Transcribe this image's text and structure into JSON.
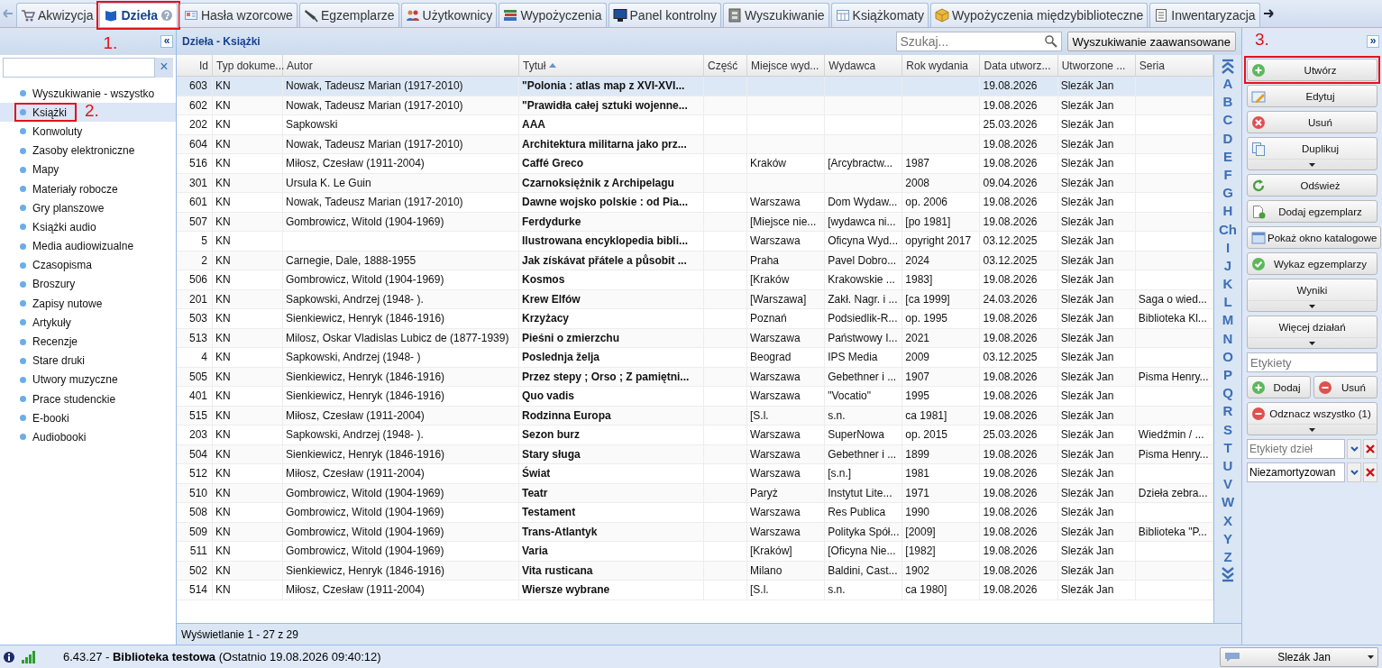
{
  "tabs": [
    {
      "label": "Akwizycja",
      "selected": false
    },
    {
      "label": "Dzieła",
      "selected": true,
      "annotation": "1."
    },
    {
      "label": "Hasła wzorcowe",
      "selected": false
    },
    {
      "label": "Egzemplarze",
      "selected": false
    },
    {
      "label": "Użytkownicy",
      "selected": false
    },
    {
      "label": "Wypożyczenia",
      "selected": false
    },
    {
      "label": "Panel kontrolny",
      "selected": false
    },
    {
      "label": "Wyszukiwanie",
      "selected": false
    },
    {
      "label": "Książkomaty",
      "selected": false
    },
    {
      "label": "Wypożyczenia międzybiblioteczne",
      "selected": false
    },
    {
      "label": "Inwentaryzacja",
      "selected": false
    }
  ],
  "sidebar": {
    "collapse": "«",
    "clear": "×",
    "items": [
      {
        "label": "Wyszukiwanie - wszystko",
        "selected": false
      },
      {
        "label": "Książki",
        "selected": true,
        "annotation": "2."
      },
      {
        "label": "Konwoluty",
        "selected": false
      },
      {
        "label": "Zasoby elektroniczne",
        "selected": false
      },
      {
        "label": "Mapy",
        "selected": false
      },
      {
        "label": "Materiały robocze",
        "selected": false
      },
      {
        "label": "Gry planszowe",
        "selected": false
      },
      {
        "label": "Książki audio",
        "selected": false
      },
      {
        "label": "Media audiowizualne",
        "selected": false
      },
      {
        "label": "Czasopisma",
        "selected": false
      },
      {
        "label": "Broszury",
        "selected": false
      },
      {
        "label": "Zapisy nutowe",
        "selected": false
      },
      {
        "label": "Artykuły",
        "selected": false
      },
      {
        "label": "Recenzje",
        "selected": false
      },
      {
        "label": "Stare druki",
        "selected": false
      },
      {
        "label": "Utwory muzyczne",
        "selected": false
      },
      {
        "label": "Prace studenckie",
        "selected": false
      },
      {
        "label": "E-booki",
        "selected": false
      },
      {
        "label": "Audiobooki",
        "selected": false
      }
    ]
  },
  "panel": {
    "title": "Dzieła - Książki",
    "search": {
      "placeholder": "Szukaj..."
    },
    "advanced_search": "Wyszukiwanie zaawansowane",
    "expand": "»",
    "annotation": "3."
  },
  "table": {
    "columns": [
      {
        "label": "Id",
        "sorted": false
      },
      {
        "label": "Typ dokume...",
        "sorted": false
      },
      {
        "label": "Autor",
        "sorted": false
      },
      {
        "label": "Tytuł",
        "sorted": true
      },
      {
        "label": "Część",
        "sorted": false
      },
      {
        "label": "Miejsce wyd...",
        "sorted": false
      },
      {
        "label": "Wydawca",
        "sorted": false
      },
      {
        "label": "Rok wydania",
        "sorted": false
      },
      {
        "label": "Data utworz...",
        "sorted": false
      },
      {
        "label": "Utworzone ...",
        "sorted": false
      },
      {
        "label": "Seria",
        "sorted": false
      }
    ],
    "rows": [
      {
        "selected": true,
        "id": "603",
        "type": "KN",
        "author": "Nowak, Tadeusz Marian (1917-2010)",
        "title": "\"Polonia : atlas map z XVI-XVI...",
        "created": "19.08.2026",
        "created_by": "Slezák Jan"
      },
      {
        "selected": false,
        "id": "602",
        "type": "KN",
        "author": "Nowak, Tadeusz Marian (1917-2010)",
        "title": "\"Prawidła całej sztuki wojenne...",
        "created": "19.08.2026",
        "created_by": "Slezák Jan"
      },
      {
        "selected": false,
        "id": "202",
        "type": "KN",
        "author": "Sapkowski",
        "title": "AAA",
        "created": "25.03.2026",
        "created_by": "Slezák Jan"
      },
      {
        "selected": false,
        "id": "604",
        "type": "KN",
        "author": "Nowak, Tadeusz Marian (1917-2010)",
        "title": "Architektura militarna jako prz...",
        "created": "19.08.2026",
        "created_by": "Slezák Jan"
      },
      {
        "selected": false,
        "id": "516",
        "type": "KN",
        "author": "Miłosz, Czesław (1911-2004)",
        "title": "Caffé Greco",
        "place": "Kraków",
        "publisher": "[Arcybractw...",
        "year": "1987",
        "created": "19.08.2026",
        "created_by": "Slezák Jan"
      },
      {
        "selected": false,
        "id": "301",
        "type": "KN",
        "author": "Ursula K. Le Guin",
        "title": "Czarnoksiężnik z Archipelagu",
        "year": "2008",
        "created": "09.04.2026",
        "created_by": "Slezák Jan"
      },
      {
        "selected": false,
        "id": "601",
        "type": "KN",
        "author": "Nowak, Tadeusz Marian (1917-2010)",
        "title": "Dawne wojsko polskie : od Pia...",
        "place": "Warszawa",
        "publisher": "Dom Wydaw...",
        "year": "op. 2006",
        "created": "19.08.2026",
        "created_by": "Slezák Jan"
      },
      {
        "selected": false,
        "id": "507",
        "type": "KN",
        "author": "Gombrowicz, Witold (1904-1969)",
        "title": "Ferdydurke",
        "place": "[Miejsce nie...",
        "publisher": "[wydawca ni...",
        "year": "[po 1981]",
        "created": "19.08.2026",
        "created_by": "Slezák Jan"
      },
      {
        "selected": false,
        "id": "5",
        "type": "KN",
        "title": "Ilustrowana encyklopedia bibli...",
        "place": "Warszawa",
        "publisher": "Oficyna Wyd...",
        "year": "opyright 2017",
        "created": "03.12.2025",
        "created_by": "Slezák Jan"
      },
      {
        "selected": false,
        "id": "2",
        "type": "KN",
        "author": "Carnegie, Dale, 1888-1955",
        "title": "Jak získávat přátele a působit ...",
        "place": "Praha",
        "publisher": "Pavel Dobro...",
        "year": "2024",
        "created": "03.12.2025",
        "created_by": "Slezák Jan"
      },
      {
        "selected": false,
        "id": "506",
        "type": "KN",
        "author": "Gombrowicz, Witold (1904-1969)",
        "title": "Kosmos",
        "place": "[Kraków",
        "publisher": "Krakowskie ...",
        "year": "1983]",
        "created": "19.08.2026",
        "created_by": "Slezák Jan"
      },
      {
        "selected": false,
        "id": "201",
        "type": "KN",
        "author": "Sapkowski, Andrzej (1948- ).",
        "title": "Krew Elfów",
        "place": "[Warszawa]",
        "publisher": "Zakł. Nagr. i ...",
        "year": "[ca 1999]",
        "created": "24.03.2026",
        "created_by": "Slezák Jan",
        "series": "Saga o wied..."
      },
      {
        "selected": false,
        "id": "503",
        "type": "KN",
        "author": "Sienkiewicz, Henryk (1846-1916)",
        "title": "Krzyżacy",
        "place": "Poznań",
        "publisher": "Podsiedlik-R...",
        "year": "op. 1995",
        "created": "19.08.2026",
        "created_by": "Slezák Jan",
        "series": "Biblioteka Kl..."
      },
      {
        "selected": false,
        "id": "513",
        "type": "KN",
        "author": "Milosz, Oskar Vladislas Lubicz de (1877-1939)",
        "title": "Pieśni o zmierzchu",
        "place": "Warszawa",
        "publisher": "Państwowy I...",
        "year": "2021",
        "created": "19.08.2026",
        "created_by": "Slezák Jan"
      },
      {
        "selected": false,
        "id": "4",
        "type": "KN",
        "author": "Sapkowski, Andrzej (1948- )",
        "title": "Poslednja želja",
        "place": "Beograd",
        "publisher": "IPS Media",
        "year": "2009",
        "created": "03.12.2025",
        "created_by": "Slezák Jan"
      },
      {
        "selected": false,
        "id": "505",
        "type": "KN",
        "author": "Sienkiewicz, Henryk (1846-1916)",
        "title": "Przez stepy ; Orso ; Z pamiętni...",
        "place": "Warszawa",
        "publisher": "Gebethner i ...",
        "year": "1907",
        "created": "19.08.2026",
        "created_by": "Slezák Jan",
        "series": "Pisma Henry..."
      },
      {
        "selected": false,
        "id": "401",
        "type": "KN",
        "author": "Sienkiewicz, Henryk (1846-1916)",
        "title": "Quo vadis",
        "place": "Warszawa",
        "publisher": "\"Vocatio\"",
        "year": "1995",
        "created": "19.08.2026",
        "created_by": "Slezák Jan"
      },
      {
        "selected": false,
        "id": "515",
        "type": "KN",
        "author": "Miłosz, Czesław (1911-2004)",
        "title": "Rodzinna Europa",
        "place": "[S.l.",
        "publisher": "s.n.",
        "year": "ca 1981]",
        "created": "19.08.2026",
        "created_by": "Slezák Jan"
      },
      {
        "selected": false,
        "id": "203",
        "type": "KN",
        "author": "Sapkowski, Andrzej (1948- ).",
        "title": "Sezon burz",
        "place": "Warszawa",
        "publisher": "SuperNowa",
        "year": "op. 2015",
        "created": "25.03.2026",
        "created_by": "Slezák Jan",
        "series": "Wiedźmin / ..."
      },
      {
        "selected": false,
        "id": "504",
        "type": "KN",
        "author": "Sienkiewicz, Henryk (1846-1916)",
        "title": "Stary sługa",
        "place": "Warszawa",
        "publisher": "Gebethner i ...",
        "year": "1899",
        "created": "19.08.2026",
        "created_by": "Slezák Jan",
        "series": "Pisma Henry..."
      },
      {
        "selected": false,
        "id": "512",
        "type": "KN",
        "author": "Miłosz, Czesław (1911-2004)",
        "title": "Świat",
        "place": "Warszawa",
        "publisher": "[s.n.]",
        "year": "1981",
        "created": "19.08.2026",
        "created_by": "Slezák Jan"
      },
      {
        "selected": false,
        "id": "510",
        "type": "KN",
        "author": "Gombrowicz, Witold (1904-1969)",
        "title": "Teatr",
        "place": "Paryż",
        "publisher": "Instytut Lite...",
        "year": "1971",
        "created": "19.08.2026",
        "created_by": "Slezák Jan",
        "series": "Dzieła zebra..."
      },
      {
        "selected": false,
        "id": "508",
        "type": "KN",
        "author": "Gombrowicz, Witold (1904-1969)",
        "title": "Testament",
        "place": "Warszawa",
        "publisher": "Res Publica",
        "year": "1990",
        "created": "19.08.2026",
        "created_by": "Slezák Jan"
      },
      {
        "selected": false,
        "id": "509",
        "type": "KN",
        "author": "Gombrowicz, Witold (1904-1969)",
        "title": "Trans-Atlantyk",
        "place": "Warszawa",
        "publisher": "Polityka Spół...",
        "year": "[2009]",
        "created": "19.08.2026",
        "created_by": "Slezák Jan",
        "series": "Biblioteka \"P..."
      },
      {
        "selected": false,
        "id": "511",
        "type": "KN",
        "author": "Gombrowicz, Witold (1904-1969)",
        "title": "Varia",
        "place": "[Kraków]",
        "publisher": "[Oficyna Nie...",
        "year": "[1982]",
        "created": "19.08.2026",
        "created_by": "Slezák Jan"
      },
      {
        "selected": false,
        "id": "502",
        "type": "KN",
        "author": "Sienkiewicz, Henryk (1846-1916)",
        "title": "Vita rusticana",
        "place": "Milano",
        "publisher": "Baldini, Cast...",
        "year": "1902",
        "created": "19.08.2026",
        "created_by": "Slezák Jan"
      },
      {
        "selected": false,
        "id": "514",
        "type": "KN",
        "author": "Miłosz, Czesław (1911-2004)",
        "title": "Wiersze wybrane",
        "place": "[S.l.",
        "publisher": "s.n.",
        "year": "ca 1980]",
        "created": "19.08.2026",
        "created_by": "Slezák Jan"
      }
    ],
    "footer": "Wyświetlanie 1 - 27 z 29"
  },
  "alphabet": [
    "A",
    "B",
    "C",
    "D",
    "E",
    "F",
    "G",
    "H",
    "Ch",
    "I",
    "J",
    "K",
    "L",
    "M",
    "N",
    "O",
    "P",
    "Q",
    "R",
    "S",
    "T",
    "U",
    "V",
    "W",
    "X",
    "Y",
    "Z"
  ],
  "actions": {
    "buttons": [
      {
        "label": "Utwórz",
        "kind": "button",
        "annotated": true
      },
      {
        "label": "Edytuj",
        "kind": "button",
        "annotated": false
      },
      {
        "label": "Usuń",
        "kind": "button",
        "annotated": false
      },
      {
        "label": "Duplikuj",
        "kind": "menu",
        "annotated": false
      },
      {
        "label": "Odśwież",
        "kind": "button",
        "annotated": false
      },
      {
        "label": "Dodaj egzemplarz",
        "kind": "button",
        "annotated": false
      },
      {
        "label": "Pokaż okno katalogowe",
        "kind": "button",
        "annotated": false
      },
      {
        "label": "Wykaz egzemplarzy",
        "kind": "button",
        "annotated": false
      },
      {
        "label": "Wyniki",
        "kind": "menu",
        "annotated": false
      },
      {
        "label": "Więcej działań",
        "kind": "menu",
        "annotated": false
      }
    ],
    "labels_field": {
      "placeholder": "Etykiety"
    },
    "label_buttons": [
      "Dodaj",
      "Usuń"
    ],
    "unmark": {
      "label": "Odznacz wszystko (1)",
      "kind": "menu"
    },
    "filters": [
      {
        "placeholder": "Etykiety dzieł"
      },
      {
        "value": "Niezamortyzowan"
      }
    ]
  },
  "status_bar": {
    "text": "6.43.27 - **Biblioteka testowa** (Ostatnio 19.08.2026 09:40:12)",
    "user": "Slezák Jan"
  }
}
